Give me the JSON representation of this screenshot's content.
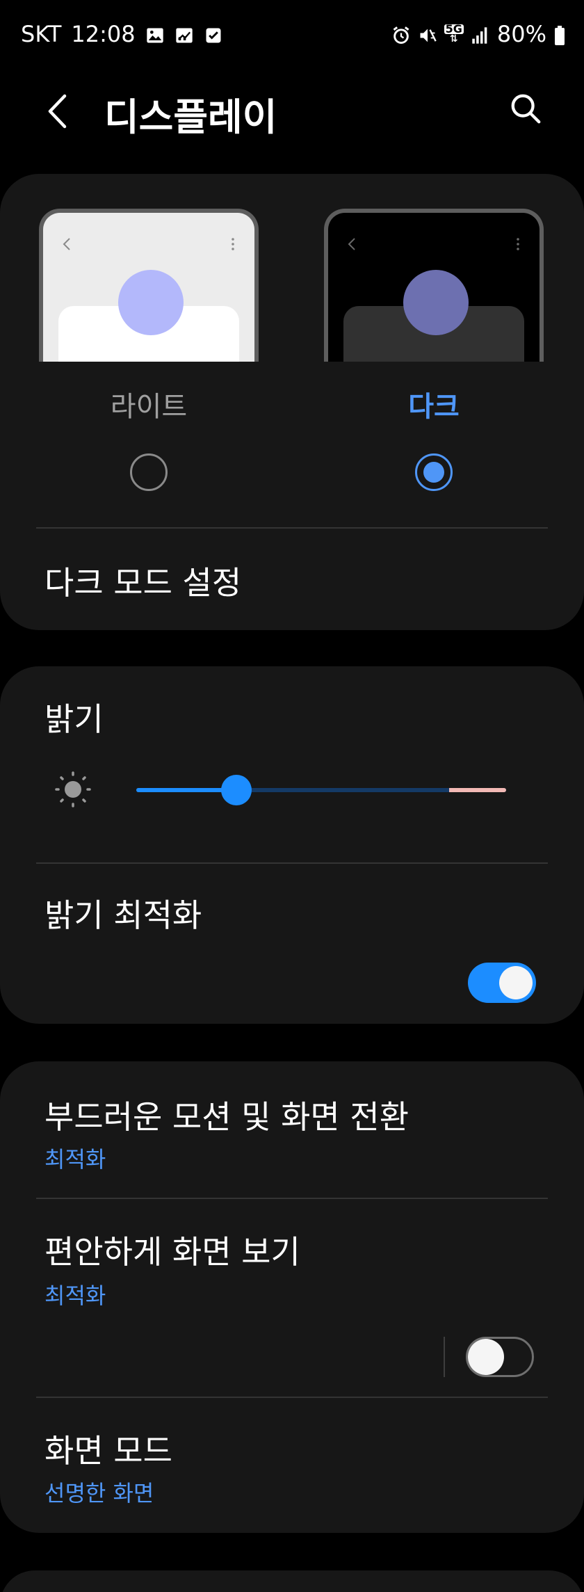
{
  "status_bar": {
    "carrier": "SKT",
    "time": "12:08",
    "network": "5G",
    "battery": "80%"
  },
  "header": {
    "title": "디스플레이"
  },
  "theme": {
    "options": [
      {
        "label": "라이트",
        "selected": false
      },
      {
        "label": "다크",
        "selected": true
      }
    ],
    "dark_mode_settings": "다크 모드 설정"
  },
  "brightness": {
    "title": "밝기",
    "level": 0.27,
    "adaptive_label": "밝기 최적화",
    "adaptive_on": true
  },
  "settings": {
    "motion_title": "부드러운 모션 및 화면 전환",
    "motion_value": "최적화",
    "eye_comfort_title": "편안하게 화면 보기",
    "eye_comfort_value": "최적화",
    "eye_comfort_on": false,
    "screen_mode_title": "화면 모드",
    "screen_mode_value": "선명한 화면"
  },
  "colors": {
    "accent": "#4f96f7",
    "toggle_on": "#1c8dff",
    "card_bg": "#171717"
  }
}
